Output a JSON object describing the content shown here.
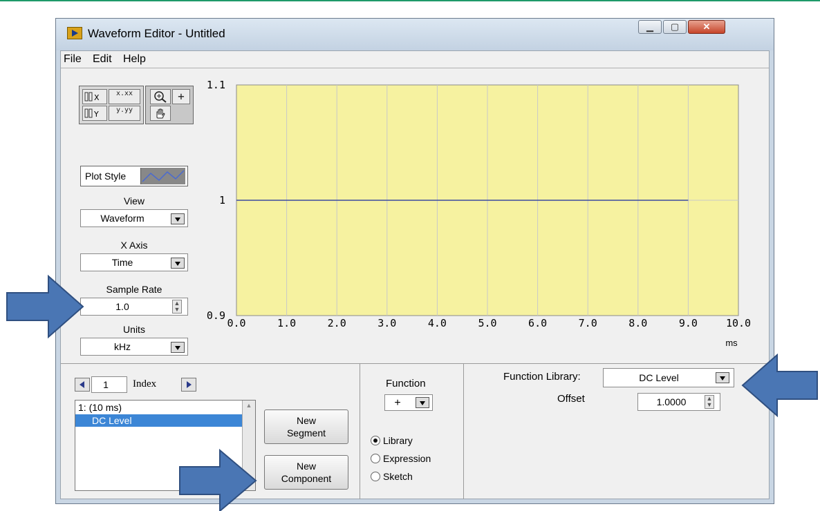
{
  "window": {
    "title": "Waveform Editor - Untitled"
  },
  "menu": [
    "File",
    "Edit",
    "Help"
  ],
  "toolbar": {
    "x_format": "x.xx",
    "y_format": "y.yy"
  },
  "plot_style": {
    "label": "Plot Style"
  },
  "view": {
    "label": "View",
    "value": "Waveform"
  },
  "x_axis": {
    "label": "X Axis",
    "value": "Time"
  },
  "sample_rate": {
    "label": "Sample Rate",
    "value": "1.0"
  },
  "units": {
    "label": "Units",
    "value": "kHz"
  },
  "graph": {
    "plot_bg": "#f6f2a0",
    "line_color": "#3a4aa0",
    "y_ticks": [
      "1.1",
      "1",
      "0.9"
    ],
    "x_ticks": [
      "0.0",
      "1.0",
      "2.0",
      "3.0",
      "4.0",
      "5.0",
      "6.0",
      "7.0",
      "8.0",
      "9.0",
      "10.0"
    ],
    "x_unit": "ms",
    "waveform": {
      "level": 1.0,
      "x_start": 0.0,
      "x_end": 9.0
    },
    "x_range": [
      0,
      10
    ],
    "y_range": [
      0.9,
      1.1
    ]
  },
  "index": {
    "value": "1",
    "label": "Index"
  },
  "segment_list": {
    "header": "1:  (10 ms)",
    "selected": "DC Level"
  },
  "buttons": {
    "new_segment": [
      "New",
      "Segment"
    ],
    "new_component": [
      "New",
      "Component"
    ]
  },
  "function": {
    "label": "Function",
    "operator": "+"
  },
  "mode": {
    "options": [
      "Library",
      "Expression",
      "Sketch"
    ],
    "selected": "Library"
  },
  "function_library": {
    "label": "Function Library:",
    "value": "DC Level"
  },
  "offset": {
    "label": "Offset",
    "value": "1.0000"
  },
  "colors": {
    "arrow": "#4a76b4",
    "arrow_border": "#2f4f80",
    "selection": "#3c86d6"
  }
}
